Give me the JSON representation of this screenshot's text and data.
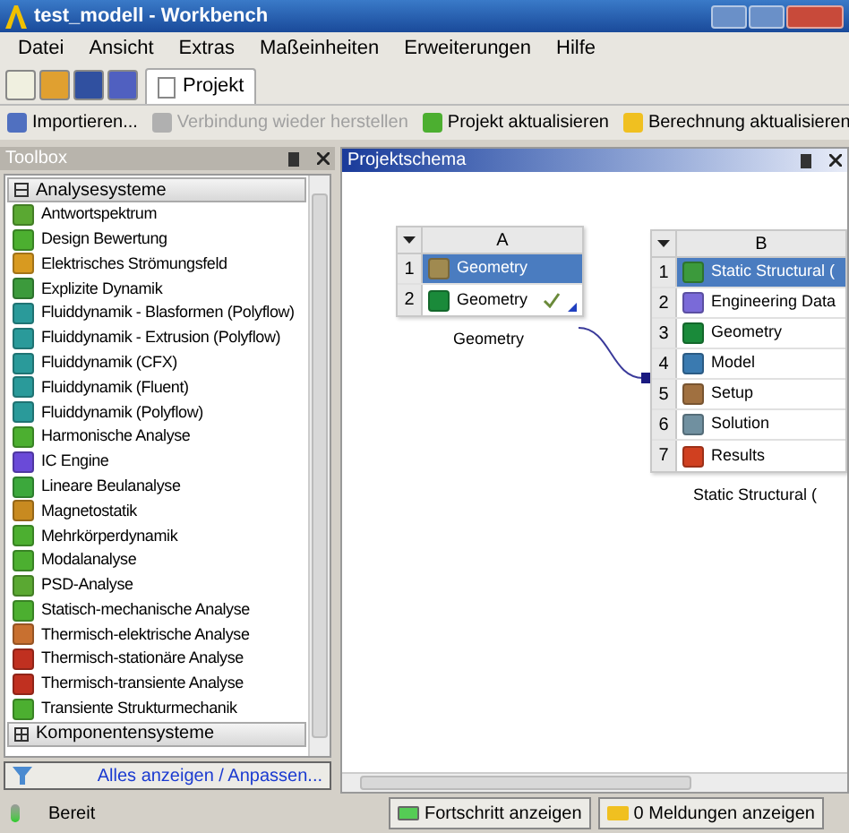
{
  "window": {
    "title": "test_modell - Workbench"
  },
  "menu": [
    "Datei",
    "Ansicht",
    "Extras",
    "Maßeinheiten",
    "Erweiterungen",
    "Hilfe"
  ],
  "tabs": [
    {
      "label": "Projekt",
      "selected": true
    }
  ],
  "toolbar": [
    {
      "label": "Importieren...",
      "disabled": false
    },
    {
      "label": "Verbindung wieder herstellen",
      "disabled": true
    },
    {
      "label": "Projekt aktualisieren",
      "disabled": false
    },
    {
      "label": "Berechnung aktualisieren",
      "disabled": false
    }
  ],
  "toolbox": {
    "title": "Toolbox",
    "sections": [
      {
        "label": "Analysesysteme",
        "expanded": true,
        "items": [
          "Antwortspektrum",
          "Design Bewertung",
          "Elektrisches Strömungsfeld",
          "Explizite Dynamik",
          "Fluiddynamik - Blasformen (Polyflow)",
          "Fluiddynamik - Extrusion (Polyflow)",
          "Fluiddynamik (CFX)",
          "Fluiddynamik (Fluent)",
          "Fluiddynamik (Polyflow)",
          "Harmonische Analyse",
          "IC Engine",
          "Lineare Beulanalyse",
          "Magnetostatik",
          "Mehrkörperdynamik",
          "Modalanalyse",
          "PSD-Analyse",
          "Statisch-mechanische Analyse",
          "Thermisch-elektrische Analyse",
          "Thermisch-stationäre Analyse",
          "Thermisch-transiente Analyse",
          "Transiente Strukturmechanik"
        ]
      },
      {
        "label": "Komponentensysteme",
        "expanded": false
      }
    ],
    "footer_link": "Alles anzeigen / Anpassen..."
  },
  "schema": {
    "title": "Projektschema",
    "systems": [
      {
        "column": "A",
        "caption": "Geometry",
        "rows": [
          {
            "number": "1",
            "label": "Geometry",
            "selected": true,
            "up_to_date": false
          },
          {
            "number": "2",
            "label": "Geometry",
            "selected": false,
            "up_to_date": true
          }
        ]
      },
      {
        "column": "B",
        "caption": "Static Structural (",
        "rows": [
          {
            "number": "1",
            "label": "Static Structural (",
            "selected": true
          },
          {
            "number": "2",
            "label": "Engineering Data",
            "selected": false
          },
          {
            "number": "3",
            "label": "Geometry",
            "selected": false
          },
          {
            "number": "4",
            "label": "Model",
            "selected": false
          },
          {
            "number": "5",
            "label": "Setup",
            "selected": false
          },
          {
            "number": "6",
            "label": "Solution",
            "selected": false
          },
          {
            "number": "7",
            "label": "Results",
            "selected": false
          }
        ]
      }
    ]
  },
  "status_bar": {
    "text": "Bereit",
    "buttons": [
      "Fortschritt anzeigen",
      "0 Meldungen anzeigen"
    ]
  }
}
